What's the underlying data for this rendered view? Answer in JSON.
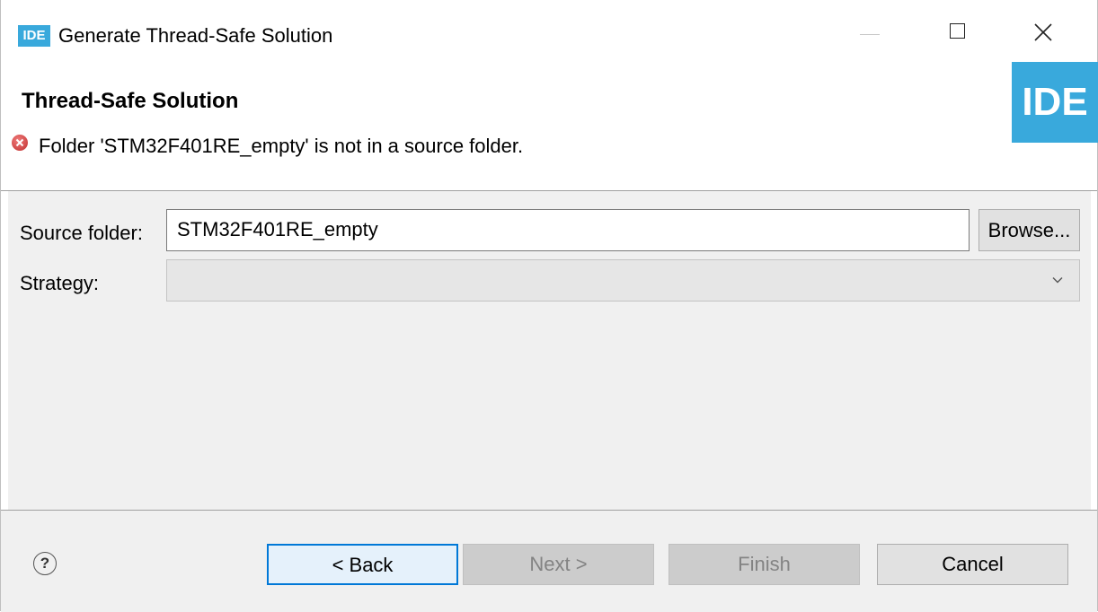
{
  "window": {
    "logo_text": "IDE",
    "title": "Generate Thread-Safe Solution"
  },
  "header": {
    "title": "Thread-Safe Solution",
    "error_message": "Folder 'STM32F401RE_empty' is not in a source folder.",
    "badge_text": "IDE"
  },
  "form": {
    "source_folder_label": "Source folder:",
    "source_folder_value": "STM32F401RE_empty",
    "browse_label": "Browse...",
    "strategy_label": "Strategy:",
    "strategy_value": ""
  },
  "footer": {
    "help_glyph": "?",
    "back_label": "< Back",
    "next_label": "Next >",
    "finish_label": "Finish",
    "cancel_label": "Cancel"
  },
  "colors": {
    "brand_blue": "#39a9dc",
    "focus_blue": "#0078d7",
    "error_red": "#c0302f",
    "disabled_text": "#838383"
  },
  "icons": {
    "minimize": "minimize-icon",
    "maximize": "maximize-icon",
    "close": "close-icon",
    "error": "error-icon",
    "dropdown": "chevron-down-icon",
    "help": "help-icon"
  }
}
